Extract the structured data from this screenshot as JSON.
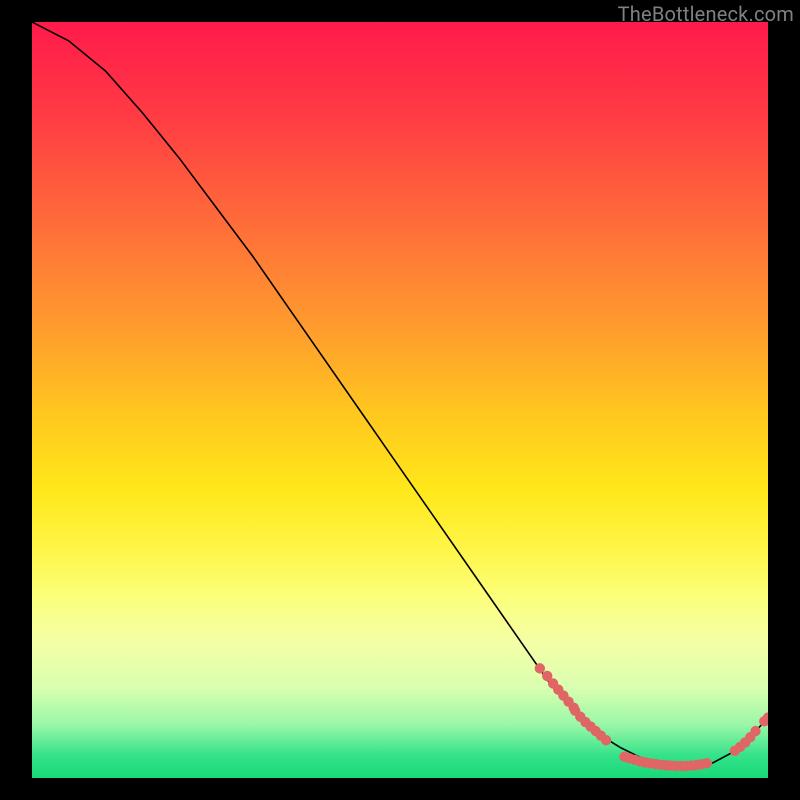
{
  "watermark": "TheBottleneck.com",
  "colors": {
    "dot": "#e06666",
    "curve": "#000000"
  },
  "chart_data": {
    "type": "line",
    "title": "",
    "xlabel": "",
    "ylabel": "",
    "xlim": [
      0,
      100
    ],
    "ylim": [
      0,
      100
    ],
    "grid": false,
    "legend": false,
    "series": [
      {
        "name": "curve",
        "x": [
          0,
          5,
          10,
          15,
          20,
          25,
          30,
          35,
          40,
          45,
          50,
          55,
          60,
          65,
          70,
          72.5,
          75,
          77.5,
          80,
          82.5,
          85,
          87.5,
          90,
          92.5,
          95,
          97.5,
          100
        ],
        "y": [
          100,
          97.5,
          93.5,
          88,
          82,
          75.5,
          69,
          62,
          55,
          48,
          41,
          34,
          27,
          20,
          13,
          10,
          7.5,
          5.5,
          4,
          2.8,
          2,
          1.6,
          1.5,
          2,
          3.3,
          5.3,
          8
        ]
      }
    ],
    "dot_clusters": [
      {
        "name": "descent-cluster",
        "points": [
          {
            "x": 69,
            "y": 14.5
          },
          {
            "x": 70,
            "y": 13.5
          },
          {
            "x": 70.8,
            "y": 12.5
          },
          {
            "x": 71.5,
            "y": 11.7
          },
          {
            "x": 72.2,
            "y": 10.9
          },
          {
            "x": 72.9,
            "y": 10.1
          },
          {
            "x": 73.6,
            "y": 9.3
          },
          {
            "x": 73.8,
            "y": 8.9
          },
          {
            "x": 74.5,
            "y": 8.1
          },
          {
            "x": 75.2,
            "y": 7.4
          },
          {
            "x": 75.9,
            "y": 6.8
          },
          {
            "x": 76.6,
            "y": 6.2
          },
          {
            "x": 77.3,
            "y": 5.6
          },
          {
            "x": 78.0,
            "y": 5.0
          }
        ]
      },
      {
        "name": "trough-cluster",
        "points": [
          {
            "x": 80.5,
            "y": 2.8
          },
          {
            "x": 81.2,
            "y": 2.6
          },
          {
            "x": 81.9,
            "y": 2.4
          },
          {
            "x": 82.6,
            "y": 2.2
          },
          {
            "x": 83.3,
            "y": 2.05
          },
          {
            "x": 84.0,
            "y": 1.95
          },
          {
            "x": 84.7,
            "y": 1.85
          },
          {
            "x": 85.4,
            "y": 1.75
          },
          {
            "x": 86.1,
            "y": 1.7
          },
          {
            "x": 86.8,
            "y": 1.65
          },
          {
            "x": 87.5,
            "y": 1.6
          },
          {
            "x": 88.2,
            "y": 1.58
          },
          {
            "x": 88.9,
            "y": 1.6
          },
          {
            "x": 89.6,
            "y": 1.65
          },
          {
            "x": 90.3,
            "y": 1.72
          },
          {
            "x": 91.0,
            "y": 1.82
          },
          {
            "x": 91.7,
            "y": 1.95
          }
        ]
      },
      {
        "name": "ascent-cluster",
        "points": [
          {
            "x": 95.5,
            "y": 3.6
          },
          {
            "x": 96.2,
            "y": 4.1
          },
          {
            "x": 96.9,
            "y": 4.7
          },
          {
            "x": 97.6,
            "y": 5.4
          },
          {
            "x": 98.3,
            "y": 6.2
          },
          {
            "x": 99.5,
            "y": 7.5
          },
          {
            "x": 100,
            "y": 8.0
          }
        ]
      }
    ]
  }
}
